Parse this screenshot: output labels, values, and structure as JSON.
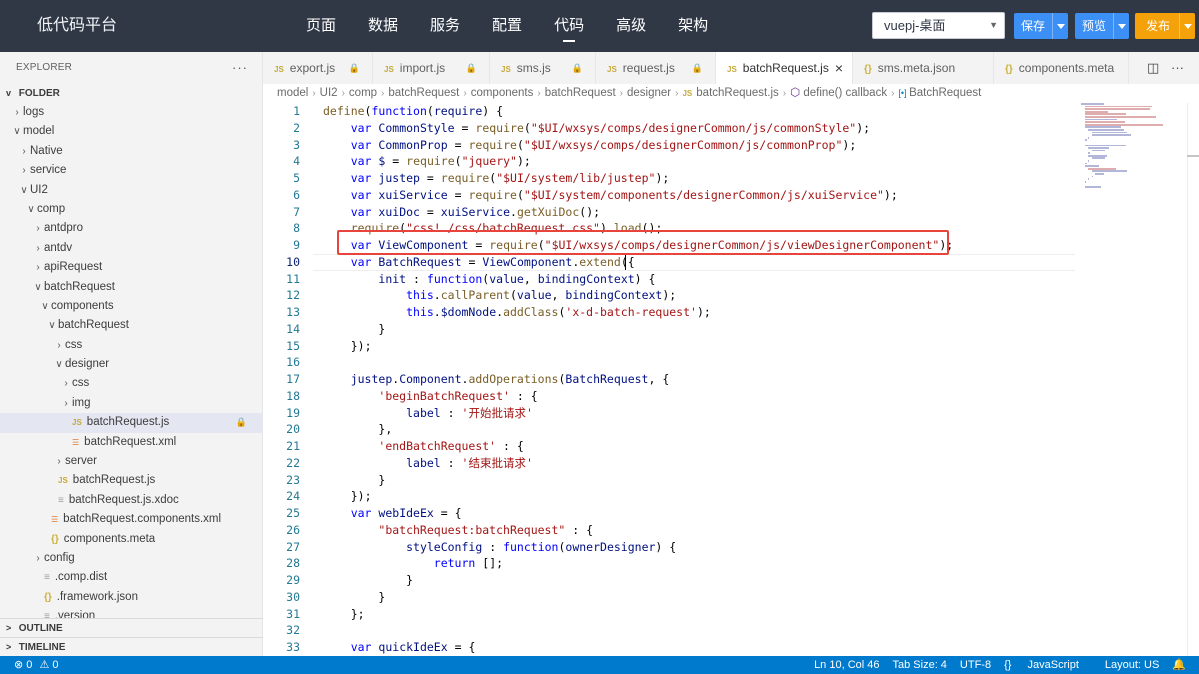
{
  "app": {
    "brand": "低代码平台",
    "nav": [
      "页面",
      "数据",
      "服务",
      "配置",
      "代码",
      "高级",
      "架构"
    ],
    "active_nav": "代码",
    "project": "vuepj-桌面",
    "buttons": {
      "save": "保存",
      "preview": "预览",
      "publish": "发布"
    }
  },
  "sidebar": {
    "title": "EXPLORER",
    "more": "···",
    "folder": "FOLDER",
    "tree": [
      {
        "label": "logs",
        "depth": 1,
        "chev": ">",
        "type": "folder"
      },
      {
        "label": "model",
        "depth": 1,
        "chev": "v",
        "type": "folder"
      },
      {
        "label": "Native",
        "depth": 2,
        "chev": ">",
        "type": "folder"
      },
      {
        "label": "service",
        "depth": 2,
        "chev": ">",
        "type": "folder"
      },
      {
        "label": "UI2",
        "depth": 2,
        "chev": "v",
        "type": "folder"
      },
      {
        "label": "comp",
        "depth": 3,
        "chev": "v",
        "type": "folder"
      },
      {
        "label": "antdpro",
        "depth": 4,
        "chev": ">",
        "type": "folder"
      },
      {
        "label": "antdv",
        "depth": 4,
        "chev": ">",
        "type": "folder"
      },
      {
        "label": "apiRequest",
        "depth": 4,
        "chev": ">",
        "type": "folder"
      },
      {
        "label": "batchRequest",
        "depth": 4,
        "chev": "v",
        "type": "folder"
      },
      {
        "label": "components",
        "depth": 5,
        "chev": "v",
        "type": "folder"
      },
      {
        "label": "batchRequest",
        "depth": 6,
        "chev": "v",
        "type": "folder"
      },
      {
        "label": "css",
        "depth": 7,
        "chev": ">",
        "type": "folder"
      },
      {
        "label": "designer",
        "depth": 7,
        "chev": "v",
        "type": "folder"
      },
      {
        "label": "css",
        "depth": 8,
        "chev": ">",
        "type": "folder"
      },
      {
        "label": "img",
        "depth": 8,
        "chev": ">",
        "type": "folder"
      },
      {
        "label": "batchRequest.js",
        "depth": 8,
        "chev": "",
        "type": "js",
        "selected": true,
        "locked": true
      },
      {
        "label": "batchRequest.xml",
        "depth": 8,
        "chev": "",
        "type": "xml"
      },
      {
        "label": "server",
        "depth": 7,
        "chev": ">",
        "type": "folder"
      },
      {
        "label": "batchRequest.js",
        "depth": 6,
        "chev": "",
        "type": "js"
      },
      {
        "label": "batchRequest.js.xdoc",
        "depth": 6,
        "chev": "",
        "type": "doc"
      },
      {
        "label": "batchRequest.components.xml",
        "depth": 5,
        "chev": "",
        "type": "xml"
      },
      {
        "label": "components.meta",
        "depth": 5,
        "chev": "",
        "type": "json"
      },
      {
        "label": "config",
        "depth": 4,
        "chev": ">",
        "type": "folder"
      },
      {
        "label": ".comp.dist",
        "depth": 4,
        "chev": "",
        "type": "doc"
      },
      {
        "label": ".framework.json",
        "depth": 4,
        "chev": "",
        "type": "json"
      },
      {
        "label": ".version",
        "depth": 4,
        "chev": "",
        "type": "doc"
      }
    ],
    "outline": "OUTLINE",
    "timeline": "TIMELINE"
  },
  "tabs": [
    {
      "label": "export.js",
      "icon": "JS",
      "locked": true,
      "active": false
    },
    {
      "label": "import.js",
      "icon": "JS",
      "locked": true,
      "active": false
    },
    {
      "label": "sms.js",
      "icon": "JS",
      "locked": true,
      "active": false
    },
    {
      "label": "request.js",
      "icon": "JS",
      "locked": true,
      "active": false
    },
    {
      "label": "batchRequest.js",
      "icon": "JS",
      "locked": false,
      "active": true
    },
    {
      "label": "sms.meta.json",
      "icon": "{}",
      "locked": false,
      "active": false
    },
    {
      "label": "components.meta",
      "icon": "{}",
      "locked": false,
      "active": false
    }
  ],
  "breadcrumb": [
    "model",
    "UI2",
    "comp",
    "batchRequest",
    "components",
    "batchRequest",
    "designer",
    "batchRequest.js",
    "define() callback",
    "BatchRequest"
  ],
  "editor": {
    "current_line": 10,
    "lines": [
      "define(function(require) {",
      "    var CommonStyle = require(\"$UI/wxsys/comps/designerCommon/js/commonStyle\");",
      "    var CommonProp = require(\"$UI/wxsys/comps/designerCommon/js/commonProp\");",
      "    var $ = require(\"jquery\");",
      "    var justep = require(\"$UI/system/lib/justep\");",
      "    var xuiService = require(\"$UI/system/components/designerCommon/js/xuiService\");",
      "    var xuiDoc = xuiService.getXuiDoc();",
      "    require(\"css!./css/batchRequest.css\").load();",
      "    var ViewComponent = require(\"$UI/wxsys/comps/designerCommon/js/viewDesignerComponent\");",
      "    var BatchRequest = ViewComponent.extend({",
      "        init : function(value, bindingContext) {",
      "            this.callParent(value, bindingContext);",
      "            this.$domNode.addClass('x-d-batch-request');",
      "        }",
      "    });",
      "",
      "    justep.Component.addOperations(BatchRequest, {",
      "        'beginBatchRequest' : {",
      "            label : '开始批请求'",
      "        },",
      "        'endBatchRequest' : {",
      "            label : '结束批请求'",
      "        }",
      "    });",
      "    var webIdeEx = {",
      "        \"batchRequest:batchRequest\" : {",
      "            styleConfig : function(ownerDesigner) {",
      "                return [];",
      "            }",
      "        }",
      "    };",
      "",
      "    var quickIdeEx = {"
    ]
  },
  "status": {
    "errors": "0",
    "warnings": "0",
    "position": "Ln 10, Col 46",
    "tab_size": "Tab Size: 4",
    "encoding": "UTF-8",
    "language": "JavaScript",
    "layout": "Layout: US"
  },
  "colors": {
    "topbar": "#303846",
    "save_btn": "#3c8ff5",
    "publish_btn": "#f5a20a",
    "statusbar": "#007acc",
    "highlight": "#e8443c"
  }
}
